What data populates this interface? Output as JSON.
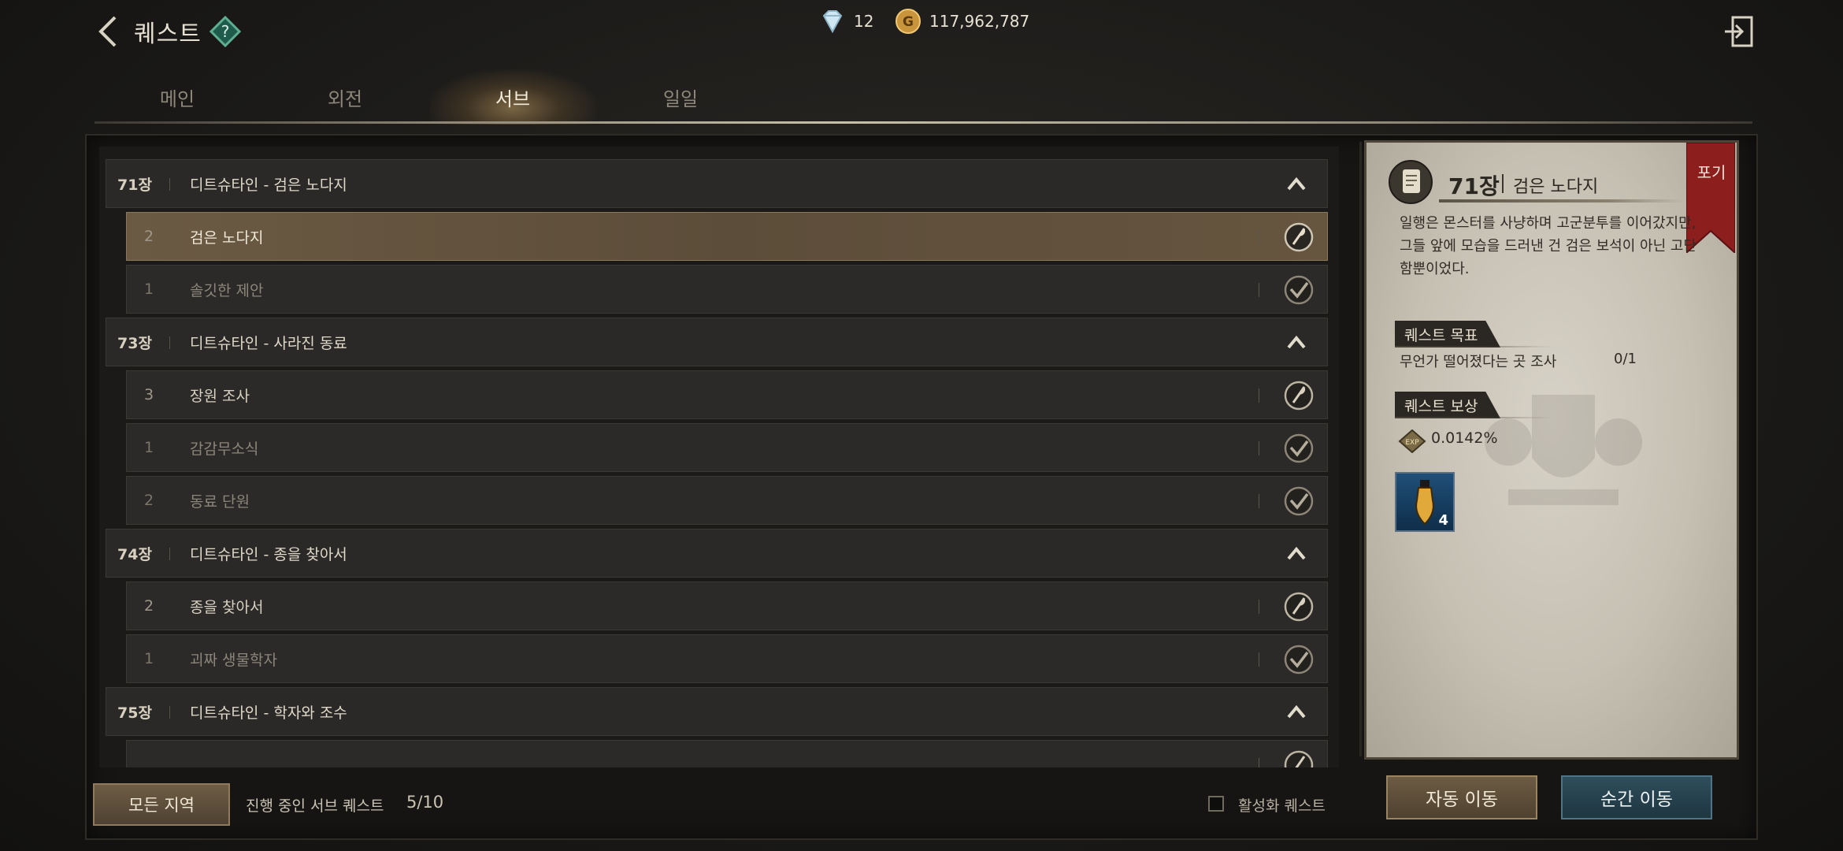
{
  "header": {
    "title": "퀘스트",
    "gems": "12",
    "gold": "117,962,787"
  },
  "tabs": [
    {
      "label": "메인",
      "active": false
    },
    {
      "label": "외전",
      "active": false
    },
    {
      "label": "서브",
      "active": true
    },
    {
      "label": "일일",
      "active": false
    }
  ],
  "quest_list": [
    {
      "kind": "chapter",
      "num": "71장",
      "label": "디트슈타인 - 검은 노다지"
    },
    {
      "kind": "quest",
      "num": "2",
      "label": "검은 노다지",
      "state": "selected"
    },
    {
      "kind": "quest",
      "num": "1",
      "label": "솔깃한 제안",
      "state": "done"
    },
    {
      "kind": "chapter",
      "num": "73장",
      "label": "디트슈타인 - 사라진 동료"
    },
    {
      "kind": "quest",
      "num": "3",
      "label": "장원 조사",
      "state": "active"
    },
    {
      "kind": "quest",
      "num": "1",
      "label": "감감무소식",
      "state": "done"
    },
    {
      "kind": "quest",
      "num": "2",
      "label": "동료 단원",
      "state": "done"
    },
    {
      "kind": "chapter",
      "num": "74장",
      "label": "디트슈타인 - 종을 찾아서"
    },
    {
      "kind": "quest",
      "num": "2",
      "label": "종을 찾아서",
      "state": "active"
    },
    {
      "kind": "quest",
      "num": "1",
      "label": "괴짜 생물학자",
      "state": "done"
    },
    {
      "kind": "chapter",
      "num": "75장",
      "label": "디트슈타인 - 학자와 조수"
    },
    {
      "kind": "quest",
      "num": "",
      "label": "",
      "state": "active"
    }
  ],
  "bottom": {
    "all_regions": "모든 지역",
    "progress_label": "진행 중인 서브 퀘스트",
    "progress_value": "5/10",
    "active_quest_label": "활성화 퀘스트"
  },
  "detail": {
    "chapter": "71장",
    "title": "검은 노다지",
    "abandon": "포기",
    "description": "일행은 몬스터를 사냥하며 고군분투를 이어갔지만, 그들 앞에 모습을 드러낸 건 검은 보석이 아닌 고단함뿐이었다.",
    "goal_header": "퀘스트 목표",
    "goal_text": "무언가 떨어졌다는 곳 조사",
    "goal_count": "0/1",
    "reward_header": "퀘스트 보상",
    "exp_icon_text": "EXP",
    "exp_value": "0.0142%",
    "reward_item_qty": "4"
  },
  "actions": {
    "auto_move": "자동 이동",
    "teleport": "순간 이동"
  },
  "colors": {
    "selected_row": "#5c4d3a",
    "teleport_button": "#2f4e5c",
    "parchment": "#d7d2c7"
  }
}
